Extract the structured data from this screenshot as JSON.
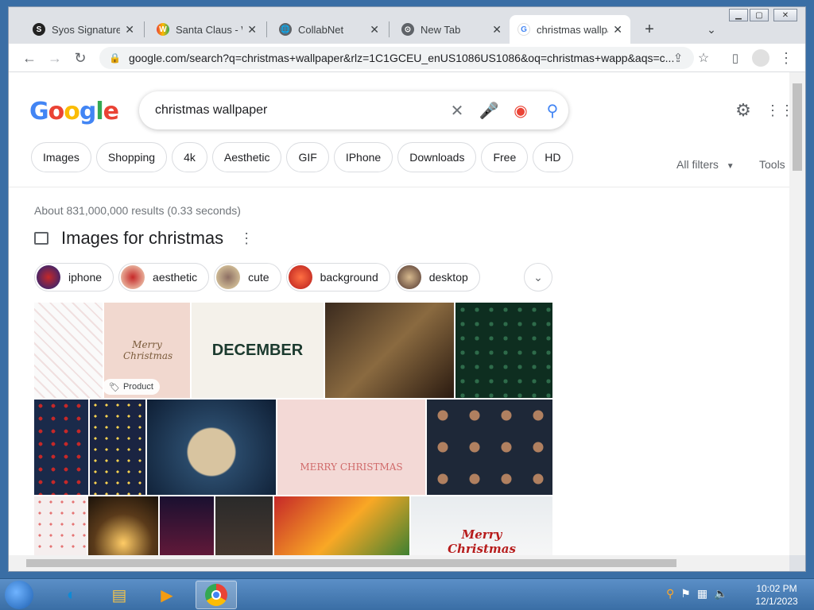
{
  "tabs": [
    {
      "label": "Syos Signature c",
      "favicon": "S"
    },
    {
      "label": "Santa Claus - Wi",
      "favicon": "W"
    },
    {
      "label": "CollabNet",
      "favicon": "🌐"
    },
    {
      "label": "New Tab",
      "favicon": "⊙"
    },
    {
      "label": "christmas wallpap",
      "favicon": "G"
    }
  ],
  "address": {
    "url": "google.com/search?q=christmas+wallpaper&rlz=1C1GCEU_enUS1086US1086&oq=christmas+wapp&aqs=c..."
  },
  "google": {
    "logo": "Google",
    "query": "christmas wallpaper",
    "filters": [
      "Images",
      "Shopping",
      "4k",
      "Aesthetic",
      "GIF",
      "IPhone",
      "Downloads",
      "Free",
      "HD"
    ],
    "all_filters": "All filters",
    "tools": "Tools",
    "stats": "About 831,000,000 results (0.33 seconds)",
    "images_heading": "Images for christmas",
    "refine_chips": [
      "iphone",
      "aesthetic",
      "cute",
      "background",
      "desktop"
    ],
    "tile_texts": {
      "merry": "Merry Christmas",
      "december": "DECEMBER",
      "merry2": "MERRY CHRISTMAS",
      "merry3": "Merry Christmas"
    },
    "product_badge": "Product"
  },
  "taskbar": {
    "time": "10:02 PM",
    "date": "12/1/2023"
  },
  "colors": {
    "accent": "#1a73e8",
    "chrome_bg": "#dee1e6"
  }
}
